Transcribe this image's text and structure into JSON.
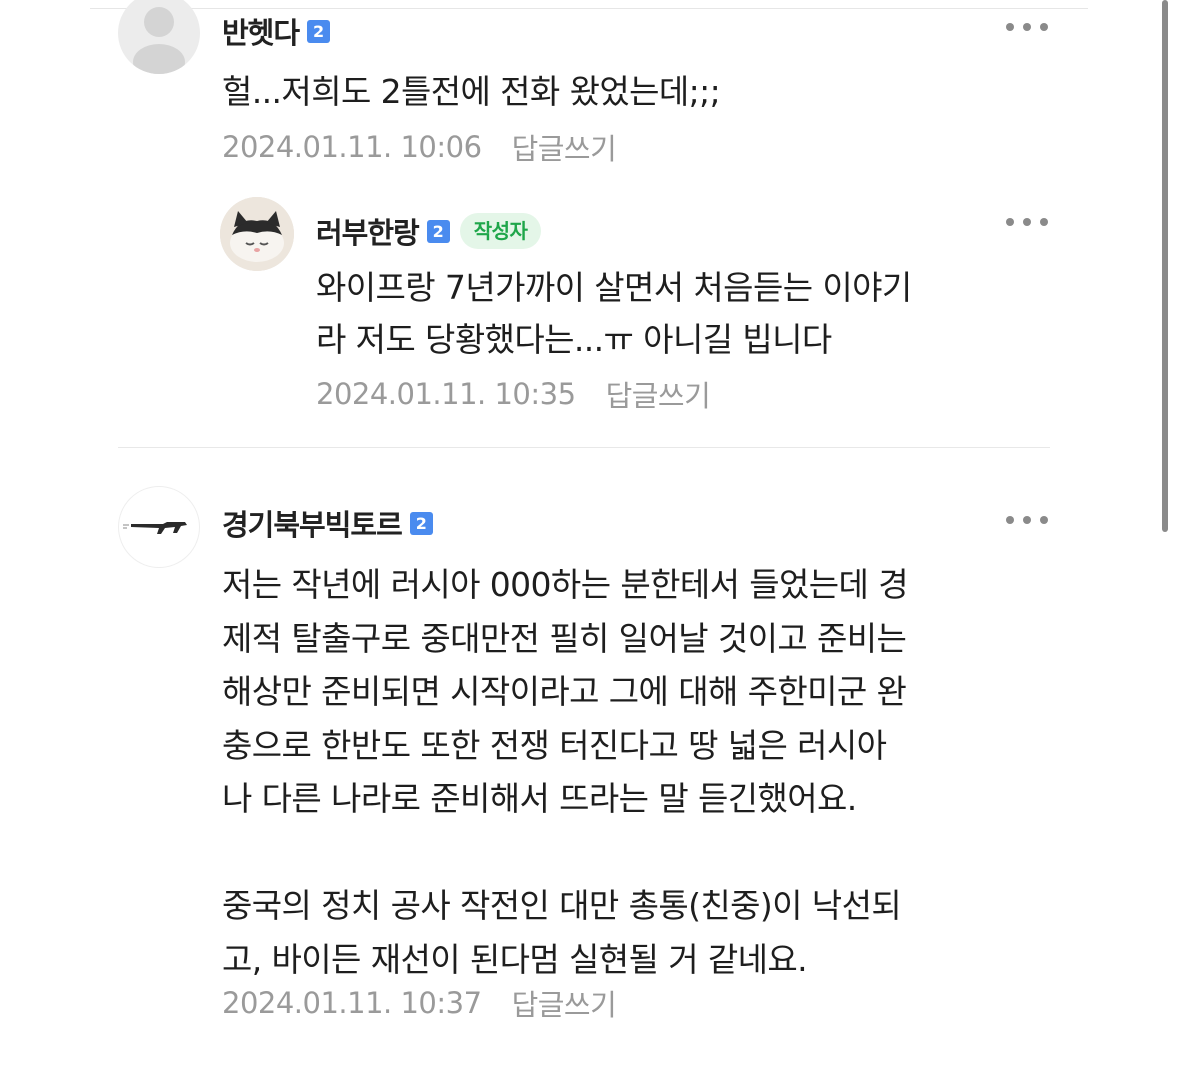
{
  "comments": [
    {
      "nickname": "반헷다",
      "level": "2",
      "body": "헐...저희도 2틀전에 전화 왔었는데;;;",
      "date": "2024.01.11. 10:06",
      "reply_label": "답글쓰기",
      "avatar": "default-avatar-icon"
    },
    {
      "nickname": "러부한랑",
      "level": "2",
      "author_badge": "작성자",
      "body": "와이프랑 7년가까이 살면서 처음듣는 이야기\n라 저도 당황했다는...ㅠ 아니길 빕니다",
      "date": "2024.01.11. 10:35",
      "reply_label": "답글쓰기",
      "avatar": "cat-avatar-icon"
    },
    {
      "nickname": "경기북부빅토르",
      "level": "2",
      "body": "저는 작년에 러시아 000하는 분한테서 들었는데 경\n제적 탈출구로 중대만전 필히 일어날 것이고 준비는\n해상만 준비되면 시작이라고 그에 대해 주한미군 완\n충으로 한반도 또한 전쟁 터진다고 땅 넓은 러시아\n나 다른 나라로 준비해서 뜨라는 말 듣긴했어요.\n\n중국의 정치 공사 작전인 대만 총통(친중)이 낙선되\n고, 바이든 재선이 된다멈 실현될 거 같네요.",
      "date": "2024.01.11. 10:37",
      "reply_label": "답글쓰기",
      "avatar": "rifle-avatar-icon"
    }
  ],
  "colors": {
    "level_badge": "#4a8bef",
    "author_badge_bg": "#e4f6e8",
    "author_badge_text": "#1fa64a",
    "meta_text": "#9a9a9a"
  }
}
